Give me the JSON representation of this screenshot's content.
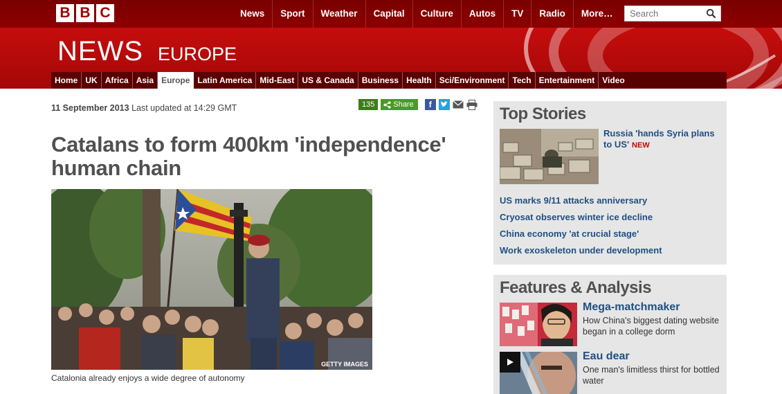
{
  "brand": {
    "letters": [
      "B",
      "B",
      "C"
    ],
    "news": "NEWS",
    "region": "EUROPE"
  },
  "topnav": [
    "News",
    "Sport",
    "Weather",
    "Capital",
    "Culture",
    "Autos",
    "TV",
    "Radio",
    "More…"
  ],
  "search": {
    "placeholder": "Search"
  },
  "sections": [
    {
      "label": "Home"
    },
    {
      "label": "UK"
    },
    {
      "label": "Africa"
    },
    {
      "label": "Asia"
    },
    {
      "label": "Europe",
      "active": true
    },
    {
      "label": "Latin America"
    },
    {
      "label": "Mid-East"
    },
    {
      "label": "US & Canada"
    },
    {
      "label": "Business"
    },
    {
      "label": "Health"
    },
    {
      "label": "Sci/Environment"
    },
    {
      "label": "Tech"
    },
    {
      "label": "Entertainment"
    },
    {
      "label": "Video"
    }
  ],
  "article": {
    "date": "11 September 2013",
    "updated": "Last updated at 14:29 GMT",
    "share_count": "135",
    "share_label": "Share",
    "headline": "Catalans to form 400km 'independence' human chain",
    "image_credit": "GETTY IMAGES",
    "caption": "Catalonia already enjoys a wide degree of autonomy"
  },
  "top_stories": {
    "heading": "Top Stories",
    "lead": "Russia 'hands Syria plans to US'",
    "lead_badge": "NEW",
    "links": [
      "US marks 9/11 attacks anniversary",
      "Cryosat observes winter ice decline",
      "China economy 'at crucial stage'",
      "Work exoskeleton under development"
    ]
  },
  "features": {
    "heading": "Features & Analysis",
    "items": [
      {
        "title": "Mega-matchmaker",
        "desc": "How China's biggest dating website began in a college dorm"
      },
      {
        "title": "Eau dear",
        "desc": "One man's limitless thirst for bottled water"
      }
    ]
  },
  "colors": {
    "bbc_red": "#a00000",
    "link_blue": "#1f4f82",
    "share_green": "#4a9b22"
  }
}
